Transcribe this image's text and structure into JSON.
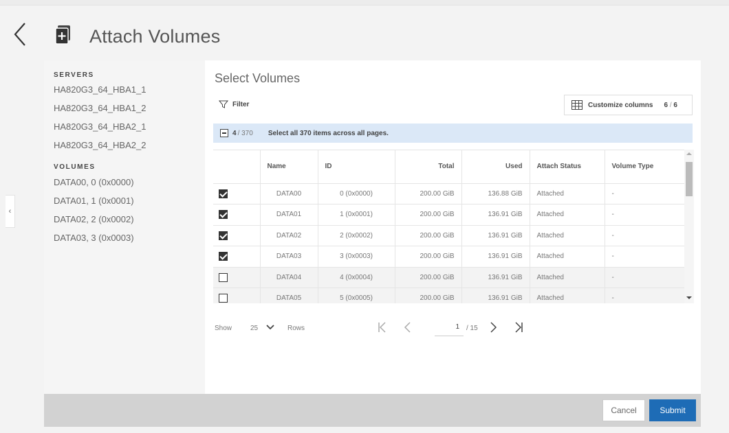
{
  "header": {
    "title": "Attach Volumes"
  },
  "sidebar": {
    "servers_heading": "SERVERS",
    "servers": [
      "HA820G3_64_HBA1_1",
      "HA820G3_64_HBA1_2",
      "HA820G3_64_HBA2_1",
      "HA820G3_64_HBA2_2"
    ],
    "volumes_heading": "VOLUMES",
    "volumes": [
      "DATA00, 0 (0x0000)",
      "DATA01, 1 (0x0001)",
      "DATA02, 2 (0x0002)",
      "DATA03, 3 (0x0003)"
    ]
  },
  "main": {
    "title": "Select Volumes",
    "filter_label": "Filter",
    "customize": {
      "label": "Customize columns",
      "shown": "6",
      "total": "6"
    },
    "selection": {
      "count": "4",
      "total": "370",
      "select_all_label": "Select all 370 items across all pages."
    },
    "table": {
      "columns": [
        "Name",
        "ID",
        "Total",
        "Used",
        "Attach Status",
        "Volume Type"
      ],
      "rows": [
        {
          "checked": true,
          "name": "DATA00",
          "id": "0 (0x0000)",
          "total": "200.00 GiB",
          "used": "136.88 GiB",
          "status": "Attached",
          "type": "-"
        },
        {
          "checked": true,
          "name": "DATA01",
          "id": "1 (0x0001)",
          "total": "200.00 GiB",
          "used": "136.91 GiB",
          "status": "Attached",
          "type": "-"
        },
        {
          "checked": true,
          "name": "DATA02",
          "id": "2 (0x0002)",
          "total": "200.00 GiB",
          "used": "136.91 GiB",
          "status": "Attached",
          "type": "-"
        },
        {
          "checked": true,
          "name": "DATA03",
          "id": "3 (0x0003)",
          "total": "200.00 GiB",
          "used": "136.91 GiB",
          "status": "Attached",
          "type": "-"
        },
        {
          "checked": false,
          "name": "DATA04",
          "id": "4 (0x0004)",
          "total": "200.00 GiB",
          "used": "136.91 GiB",
          "status": "Attached",
          "type": "-"
        },
        {
          "checked": false,
          "name": "DATA05",
          "id": "5 (0x0005)",
          "total": "200.00 GiB",
          "used": "136.91 GiB",
          "status": "Attached",
          "type": "-"
        }
      ]
    },
    "pager": {
      "show_label": "Show",
      "rows_value": "25",
      "rows_label": "Rows",
      "page": "1",
      "page_total": "/ 15"
    }
  },
  "footer": {
    "cancel_label": "Cancel",
    "submit_label": "Submit"
  },
  "colors": {
    "accent": "#1e6cb6",
    "banner": "#dbe8f7"
  }
}
